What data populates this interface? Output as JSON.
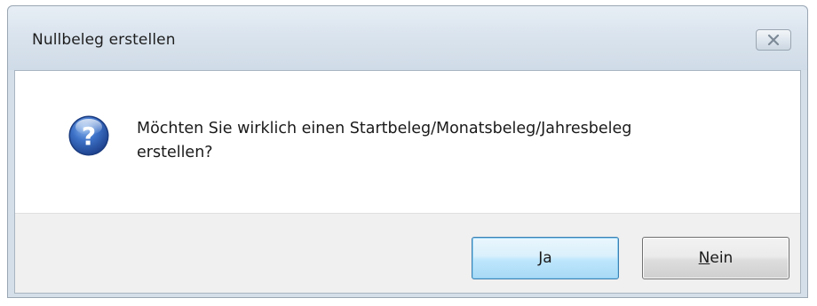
{
  "dialog": {
    "title": "Nullbeleg erstellen",
    "close_icon": "close-icon",
    "icon": "question-icon",
    "message_line1": "Möchten Sie wirklich einen Startbeleg/Monatsbeleg/Jahresbeleg",
    "message_line2": "erstellen?",
    "buttons": {
      "yes_label": "Ja",
      "no_mnemonic": "N",
      "no_rest": "ein"
    }
  },
  "colors": {
    "titlebar": "#dae4ee",
    "footer": "#f0f0f0",
    "default_button_border": "#3c7fb1",
    "icon_blue": "#2a5fb0"
  }
}
